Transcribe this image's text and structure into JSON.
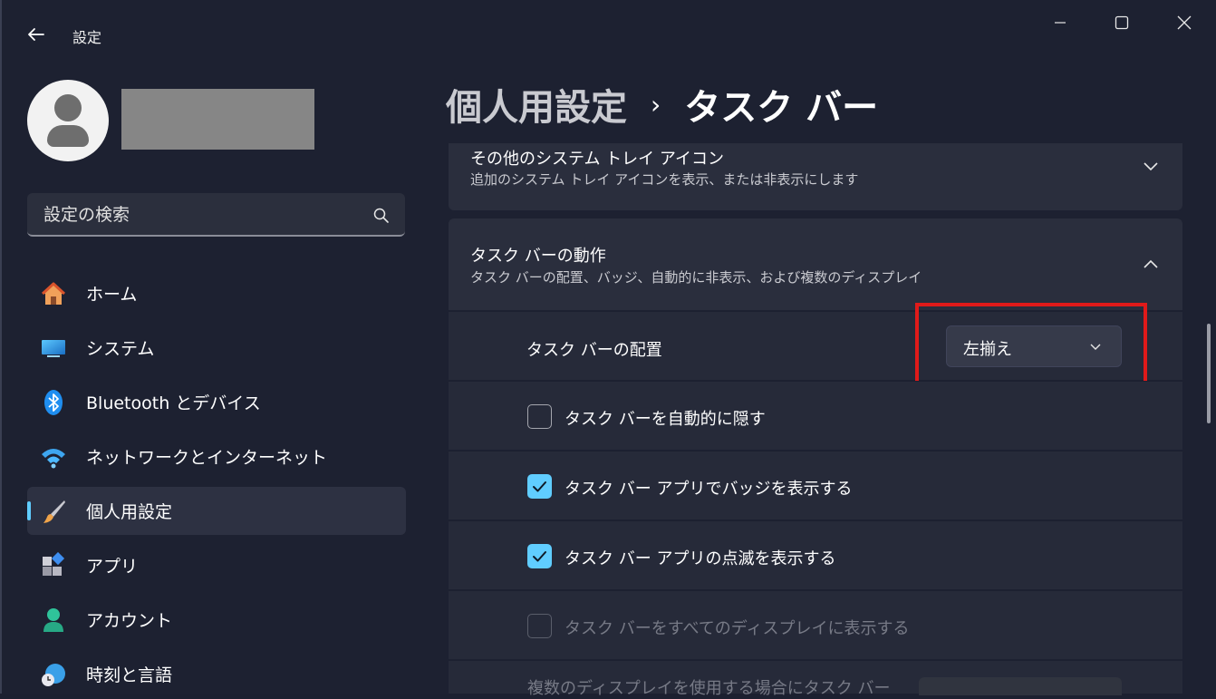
{
  "window": {
    "title": "設定"
  },
  "user": {},
  "search": {
    "placeholder": "設定の検索"
  },
  "sidebar": {
    "items": [
      {
        "label": "ホーム",
        "icon": "home-icon"
      },
      {
        "label": "システム",
        "icon": "system-icon"
      },
      {
        "label": "Bluetooth とデバイス",
        "icon": "bluetooth-icon"
      },
      {
        "label": "ネットワークとインターネット",
        "icon": "wifi-icon"
      },
      {
        "label": "個人用設定",
        "icon": "paintbrush-icon",
        "active": true
      },
      {
        "label": "アプリ",
        "icon": "apps-icon"
      },
      {
        "label": "アカウント",
        "icon": "account-icon"
      },
      {
        "label": "時刻と言語",
        "icon": "globe-clock-icon"
      }
    ]
  },
  "breadcrumb": {
    "parent": "個人用設定",
    "separator": "›",
    "current": "タスク バー"
  },
  "sections": {
    "tray": {
      "title": "その他のシステム トレイ アイコン",
      "description": "追加のシステム トレイ アイコンを表示、または非表示にします",
      "expanded": false
    },
    "behavior": {
      "title": "タスク バーの動作",
      "description": "タスク バーの配置、バッジ、自動的に非表示、および複数のディスプレイ",
      "expanded": true,
      "alignment_label": "タスク バーの配置",
      "alignment_value": "左揃え",
      "options": [
        {
          "label": "タスク バーを自動的に隠す",
          "checked": false,
          "disabled": false
        },
        {
          "label": "タスク バー アプリでバッジを表示する",
          "checked": true,
          "disabled": false
        },
        {
          "label": "タスク バー アプリの点滅を表示する",
          "checked": true,
          "disabled": false
        },
        {
          "label": "タスク バーをすべてのディスプレイに表示する",
          "checked": false,
          "disabled": true
        }
      ],
      "multi_display_label": "複数のディスプレイを使用する場合にタスク バー"
    }
  },
  "colors": {
    "accent": "#60cdff",
    "highlight": "#e01a1a"
  }
}
